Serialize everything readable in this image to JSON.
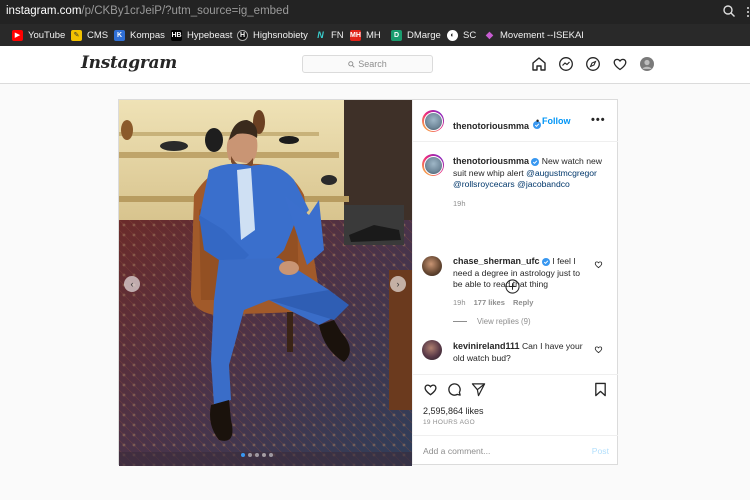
{
  "browser": {
    "url_host": "instagram.com",
    "url_path": "/p/CKBy1crJeiP/?utm_source=ig_embed",
    "bookmarks": [
      {
        "label": "YouTube",
        "icon": "youtube-icon",
        "color": "#ff0000"
      },
      {
        "label": "CMS",
        "icon": "cms-icon",
        "color": "#f2c200"
      },
      {
        "label": "Kompas",
        "icon": "kompas-icon",
        "color": "#2f6fd6"
      },
      {
        "label": "Hypebeast",
        "icon": "hypebeast-icon",
        "color": "#000000"
      },
      {
        "label": "Highsnobiety",
        "icon": "highsnobiety-icon",
        "color": "#111111"
      },
      {
        "label": "FN",
        "icon": "fn-icon",
        "color": "#00a6a6"
      },
      {
        "label": "MH",
        "icon": "mh-icon",
        "color": "#e2231a"
      },
      {
        "label": "DMarge",
        "icon": "dmarge-icon",
        "color": "#1a9c6e"
      },
      {
        "label": "SC",
        "icon": "sc-icon",
        "color": "#555555"
      },
      {
        "label": "Movement --ISEKAI",
        "icon": "isekai-icon",
        "color": "#c75cd1"
      }
    ]
  },
  "header": {
    "logo": "Instagram",
    "search_placeholder": "Search",
    "nav_icons": [
      "home-icon",
      "messenger-icon",
      "explore-icon",
      "activity-heart-icon",
      "profile-avatar"
    ]
  },
  "post": {
    "username": "thenotoriousmma",
    "follow_label": "Follow",
    "separator": "•",
    "more_label": "•••",
    "caption": {
      "username": "thenotoriousmma",
      "text": "New watch new suit new whip alert",
      "mentions": [
        "@augustmcgregor",
        "@rollsroycecars",
        "@jacobandco"
      ],
      "time": "19h"
    },
    "comments": [
      {
        "username": "chase_sherman_ufc",
        "text": "I feel I need a degree in astrology just to be able to read that thing",
        "time": "19h",
        "likes": "177 likes",
        "reply_label": "Reply",
        "view_replies": "View replies (9)"
      },
      {
        "username": "kevinireland111",
        "text": "Can I have your old watch bud?"
      }
    ],
    "likes": "2,595,864 likes",
    "timestamp": "19 HOURS AGO",
    "add_comment_placeholder": "Add a comment...",
    "post_label": "Post"
  },
  "colors": {
    "accent": "#0095f6",
    "mention": "#00376b",
    "muted": "#8e8e8e",
    "text": "#262626"
  }
}
